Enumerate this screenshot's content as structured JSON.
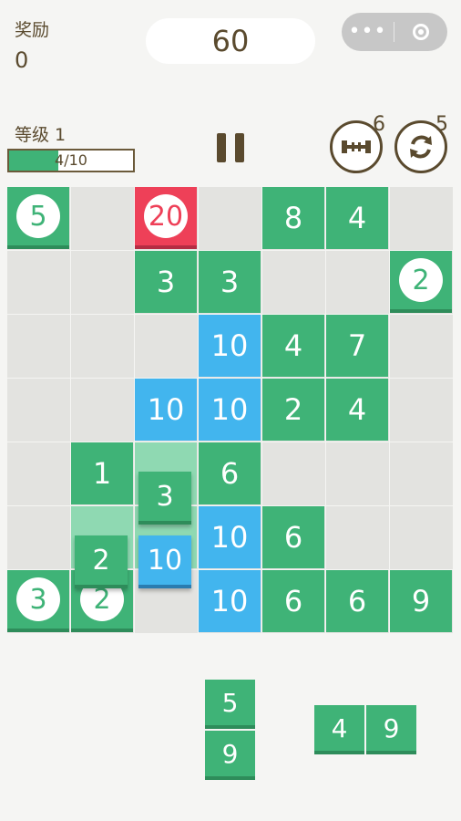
{
  "header": {
    "reward_label": "奖励",
    "reward_value": "0",
    "score": "60",
    "capsule_more": "•••",
    "level_label": "等级 1",
    "progress_text": "4/10",
    "progress_fraction": 0.4,
    "hammer_count": "6",
    "refresh_count": "5"
  },
  "colors": {
    "green": "#3fb377",
    "blue": "#42b5ee",
    "red": "#ee4058",
    "empty": "#e3e3e0",
    "text_brown": "#5a4a2e"
  },
  "board": {
    "rows": [
      [
        {
          "v": "5",
          "c": "green",
          "circle": true
        },
        null,
        {
          "v": "20",
          "c": "red",
          "circle": true
        },
        null,
        {
          "v": "8",
          "c": "green"
        },
        {
          "v": "4",
          "c": "green"
        },
        null
      ],
      [
        null,
        null,
        {
          "v": "3",
          "c": "green"
        },
        {
          "v": "3",
          "c": "green"
        },
        null,
        null,
        {
          "v": "2",
          "c": "green",
          "circle": true
        }
      ],
      [
        null,
        null,
        null,
        {
          "v": "10",
          "c": "blue"
        },
        {
          "v": "4",
          "c": "green"
        },
        {
          "v": "7",
          "c": "green"
        },
        null
      ],
      [
        null,
        null,
        {
          "v": "10",
          "c": "blue"
        },
        {
          "v": "10",
          "c": "blue"
        },
        {
          "v": "2",
          "c": "green"
        },
        {
          "v": "4",
          "c": "green"
        },
        null
      ],
      [
        null,
        {
          "v": "1",
          "c": "green"
        },
        {
          "v": "",
          "c": "lightgreen"
        },
        {
          "v": "6",
          "c": "green"
        },
        null,
        null,
        null
      ],
      [
        null,
        {
          "v": "",
          "c": "lightgreen"
        },
        {
          "v": "",
          "c": "lightgreen"
        },
        {
          "v": "10",
          "c": "blue"
        },
        {
          "v": "6",
          "c": "green"
        },
        null,
        null
      ],
      [
        {
          "v": "3",
          "c": "green",
          "circle": true
        },
        {
          "v": "2",
          "c": "green",
          "circle": true
        },
        null,
        {
          "v": "10",
          "c": "blue"
        },
        {
          "v": "6",
          "c": "green"
        },
        {
          "v": "6",
          "c": "green"
        },
        {
          "v": "9",
          "c": "green"
        }
      ]
    ],
    "dragging": [
      {
        "v": "3",
        "c": "green"
      },
      {
        "v": "2",
        "c": "green"
      },
      {
        "v": "10",
        "c": "blue"
      }
    ]
  },
  "tray": {
    "piece_a": [
      "5",
      "9"
    ],
    "piece_b": [
      "4",
      "9"
    ]
  }
}
